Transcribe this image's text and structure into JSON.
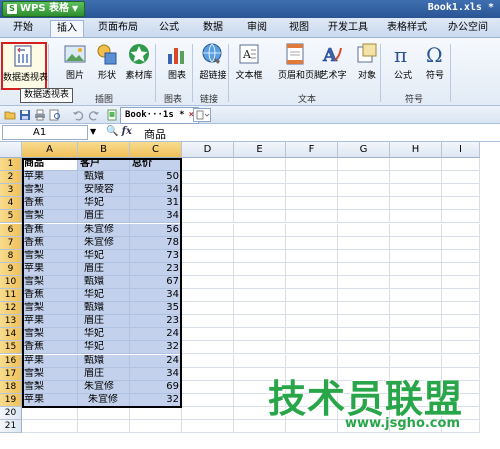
{
  "app": {
    "name": "WPS 表格",
    "doc_title": "Book1.xls *"
  },
  "menu": {
    "tabs": [
      {
        "label": "开始",
        "active": false
      },
      {
        "label": "插入",
        "active": true
      },
      {
        "label": "页面布局",
        "active": false
      },
      {
        "label": "公式",
        "active": false
      },
      {
        "label": "数据",
        "active": false
      },
      {
        "label": "审阅",
        "active": false
      },
      {
        "label": "视图",
        "active": false
      },
      {
        "label": "开发工具",
        "active": false
      },
      {
        "label": "表格样式",
        "active": false
      },
      {
        "label": "办公空间",
        "active": false
      }
    ]
  },
  "ribbon": {
    "items": [
      {
        "label": "数据透视表",
        "icon": "pivot-table-icon"
      },
      {
        "label": "图片",
        "icon": "picture-icon"
      },
      {
        "label": "形状",
        "icon": "shapes-icon"
      },
      {
        "label": "素材库",
        "icon": "clipart-icon"
      },
      {
        "label": "图表",
        "icon": "chart-icon"
      },
      {
        "label": "超链接",
        "icon": "hyperlink-icon"
      },
      {
        "label": "文本框",
        "icon": "textbox-icon"
      },
      {
        "label": "页眉和页脚",
        "icon": "header-footer-icon"
      },
      {
        "label": "艺术字",
        "icon": "wordart-icon"
      },
      {
        "label": "对象",
        "icon": "object-icon"
      },
      {
        "label": "公式",
        "icon": "equation-icon"
      },
      {
        "label": "符号",
        "icon": "symbol-icon"
      }
    ],
    "groups": [
      "插图",
      "图表",
      "链接",
      "文本",
      "符号"
    ],
    "tooltip": "数据透视表"
  },
  "toolbar": {
    "doc_tab": "Book···1s *",
    "doc_tab_close": "×"
  },
  "formula": {
    "cell_ref": "A1",
    "content": "商品"
  },
  "grid": {
    "columns": [
      "A",
      "B",
      "C",
      "D",
      "E",
      "F",
      "G",
      "H",
      "I"
    ],
    "header_row": [
      "商品",
      "客户",
      "总价"
    ],
    "rows": [
      [
        "苹果",
        "甄嬛",
        "50"
      ],
      [
        "雪梨",
        "安陵容",
        "34"
      ],
      [
        "香蕉",
        "华妃",
        "31"
      ],
      [
        "雪梨",
        "眉庄",
        "34"
      ],
      [
        "香蕉",
        "朱宜修",
        "56"
      ],
      [
        "香蕉",
        "朱宜修",
        "78"
      ],
      [
        "雪梨",
        "华妃",
        "73"
      ],
      [
        "苹果",
        "眉庄",
        "23"
      ],
      [
        "雪梨",
        "甄嬛",
        "67"
      ],
      [
        "香蕉",
        "华妃",
        "34"
      ],
      [
        "雪梨",
        "甄嬛",
        "35"
      ],
      [
        "苹果",
        "眉庄",
        "23"
      ],
      [
        "雪梨",
        "华妃",
        "24"
      ],
      [
        "香蕉",
        "华妃",
        "32"
      ],
      [
        "苹果",
        "甄嬛",
        "24"
      ],
      [
        "雪梨",
        "眉庄",
        "34"
      ],
      [
        "雪梨",
        "朱宜修",
        "69"
      ],
      [
        "苹果",
        "朱宜修",
        "32"
      ]
    ],
    "row_count": 21
  },
  "watermark": {
    "text": "技术员联盟",
    "url": "www.jsgho.com"
  },
  "colors": {
    "titlebar": "#2a5595",
    "selection": "#c3d1ec",
    "highlight": "#d62020",
    "watermark": "#2aa64a"
  }
}
